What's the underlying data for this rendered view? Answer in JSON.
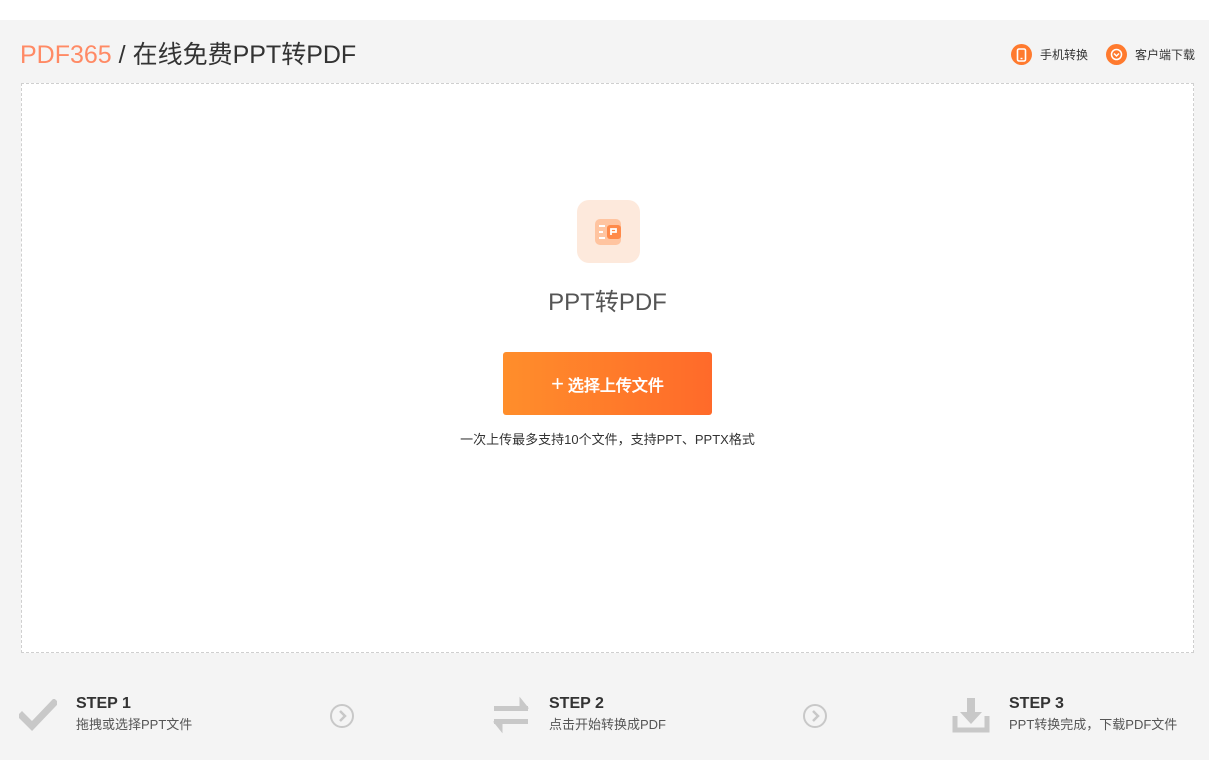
{
  "header": {
    "brand": "PDF365",
    "separator": "/",
    "page_title": "在线免费PPT转PDF",
    "links": [
      {
        "label": "手机转换",
        "icon": "phone-icon"
      },
      {
        "label": "客户端下载",
        "icon": "download-client-icon"
      }
    ]
  },
  "upload": {
    "tool_icon": "ppt-to-pdf-icon",
    "tool_name": "PPT转PDF",
    "button_plus": "+",
    "button_label": "选择上传文件",
    "hint": "一次上传最多支持10个文件，支持PPT、PPTX格式"
  },
  "steps": [
    {
      "title": "STEP 1",
      "desc": "拖拽或选择PPT文件",
      "icon": "checkmark-icon"
    },
    {
      "title": "STEP 2",
      "desc": "点击开始转换成PDF",
      "icon": "convert-arrows-icon"
    },
    {
      "title": "STEP 3",
      "desc": "PPT转换完成，下载PDF文件",
      "icon": "download-tray-icon"
    }
  ],
  "colors": {
    "brand": "#ff8a65",
    "accent": "#ff7a2e",
    "button_start": "#ff8e2b",
    "button_end": "#ff6a2a",
    "page_bg": "#f4f4f4",
    "step_icon": "#c8c8c8"
  }
}
